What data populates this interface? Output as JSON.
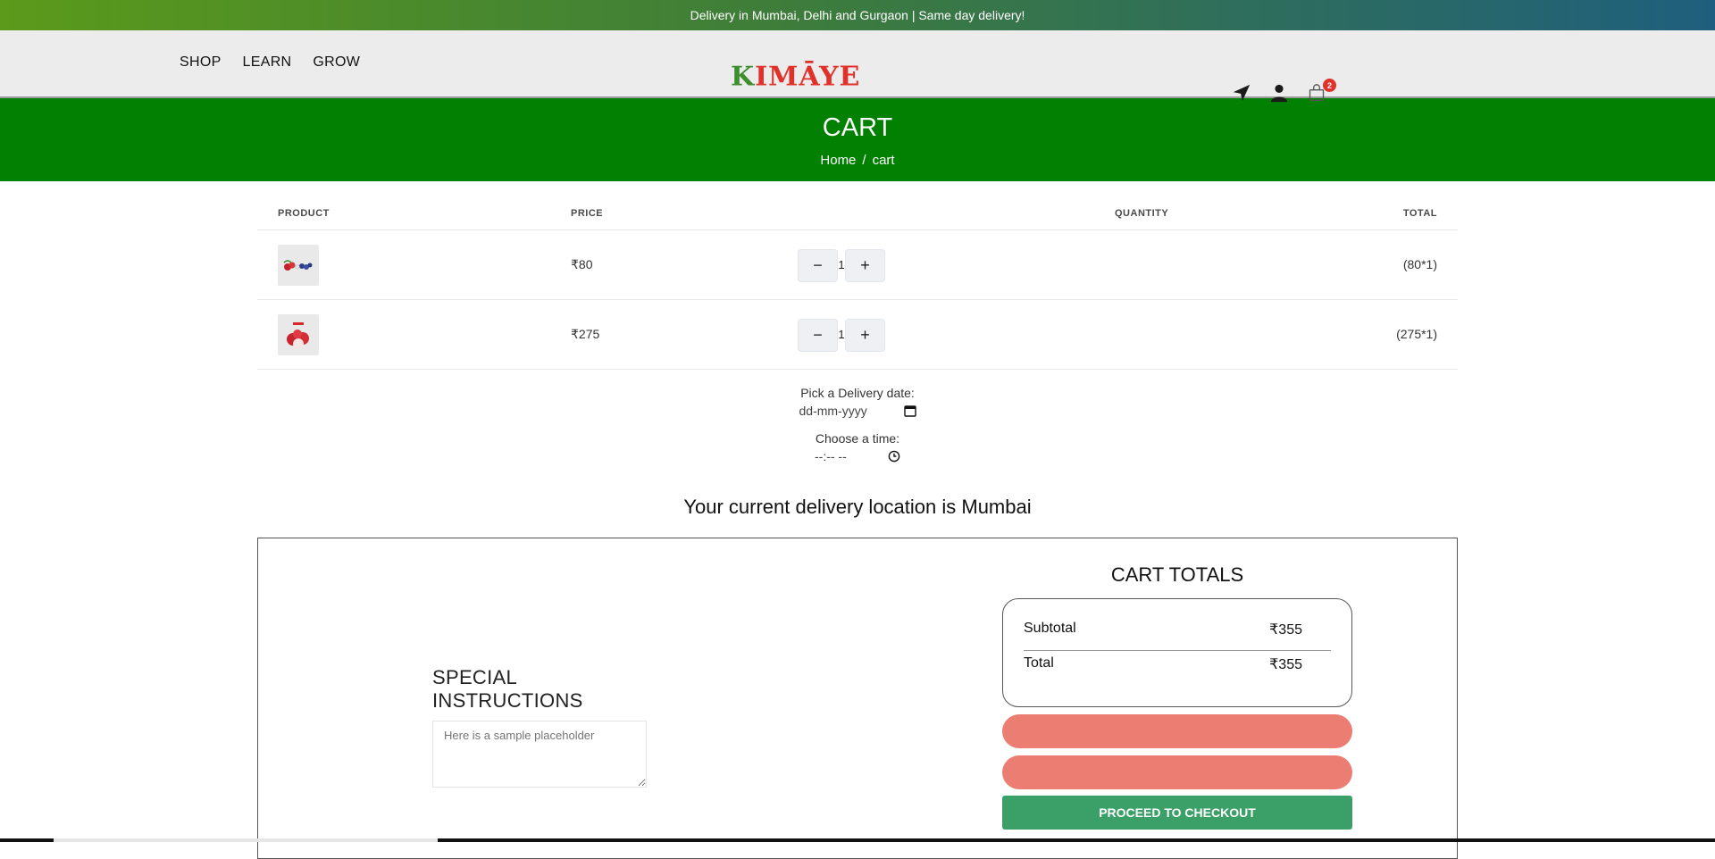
{
  "announcement": "Delivery in Mumbai, Delhi and Gurgaon | Same day delivery!",
  "nav": {
    "items": [
      "SHOP",
      "LEARN",
      "GROW"
    ]
  },
  "logo": {
    "text_first": "K",
    "text_rest": "IMĀYE",
    "colors": {
      "k": "#3d8f2e",
      "rest": "#e0312a"
    }
  },
  "header_icons": {
    "location": "location-arrow-icon",
    "account": "user-icon",
    "cart": "shopping-bag-icon",
    "cart_count": "2"
  },
  "banner": {
    "title": "CART",
    "breadcrumb": [
      "Home",
      "/",
      "cart"
    ],
    "background": "#018001"
  },
  "table": {
    "headers": {
      "product": "PRODUCT",
      "price": "PRICE",
      "quantity": "QUANTITY",
      "total": "TOTAL"
    },
    "rows": [
      {
        "thumb": "mixed-berries-thumbnail",
        "price": "₹80",
        "qty": "1",
        "total": "(80*1)"
      },
      {
        "thumb": "litchi-thumbnail",
        "price": "₹275",
        "qty": "1",
        "total": "(275*1)"
      }
    ]
  },
  "delivery": {
    "date_label": "Pick a Delivery date:",
    "date_placeholder": "dd-mm-yyyy",
    "time_label": "Choose a time:",
    "time_placeholder": "--:-- --"
  },
  "location_text": "Your current delivery location is Mumbai",
  "special_instructions": {
    "title": "SPECIAL INSTRUCTIONS",
    "placeholder": "Here is a sample placeholder"
  },
  "totals": {
    "title": "CART TOTALS",
    "subtotal_label": "Subtotal",
    "subtotal_value": "₹355",
    "total_label": "Total",
    "total_value": "₹355",
    "checkout_label": "PROCEED TO CHECKOUT",
    "pill_color": "#ec7d72",
    "checkout_color": "#3aa068"
  }
}
